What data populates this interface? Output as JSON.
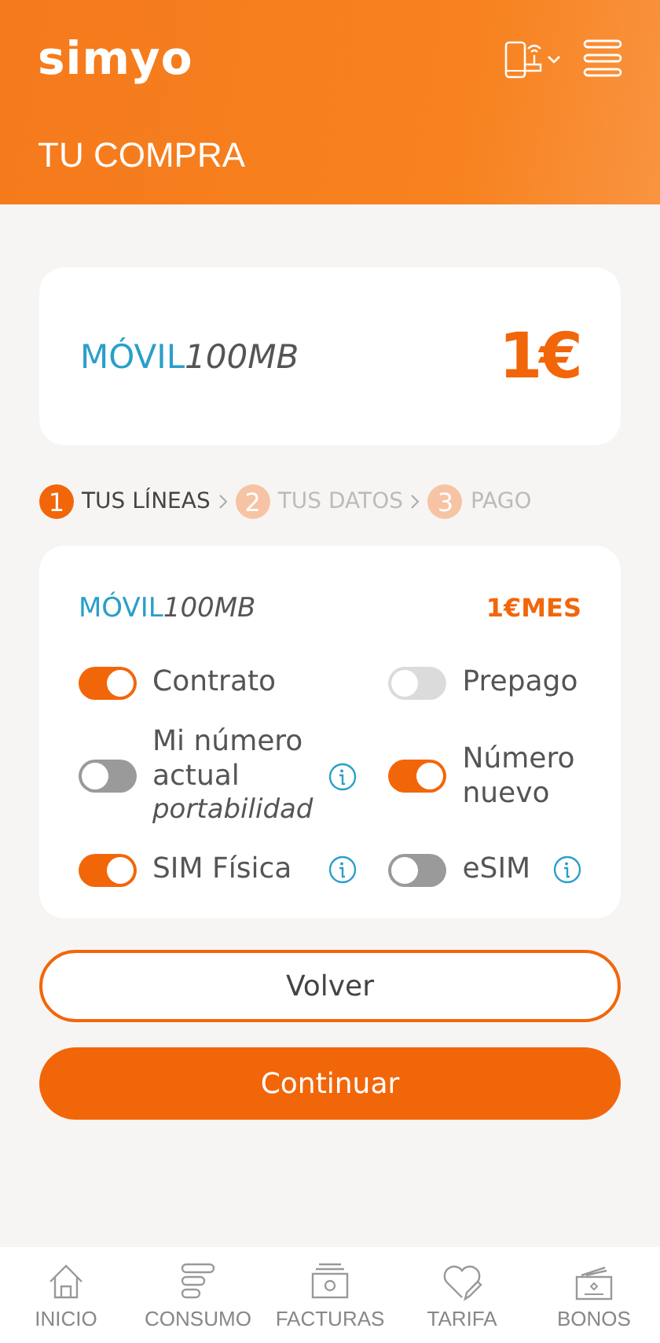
{
  "header": {
    "logo": "simyo",
    "title": "TU COMPRA"
  },
  "product": {
    "name": "MÓVIL",
    "plan": "100MB",
    "price": "1€"
  },
  "steps": [
    {
      "number": "1",
      "label": "TUS LÍNEAS",
      "selected": true
    },
    {
      "number": "2",
      "label": "TUS DATOS",
      "selected": false
    },
    {
      "number": "3",
      "label": "PAGO",
      "selected": false
    }
  ],
  "line": {
    "name": "MÓVIL",
    "plan": "100MB",
    "price": "1€MES",
    "options": [
      {
        "label": "Contrato",
        "checked": true,
        "disabled": false
      },
      {
        "label": "Prepago",
        "checked": false,
        "disabled": true
      },
      {
        "label": "Mi número actual",
        "note": "portabilidad",
        "checked": false,
        "disabled": false,
        "info": true
      },
      {
        "label": "Número nuevo",
        "checked": true,
        "disabled": false,
        "info": false
      },
      {
        "label": "SIM Física",
        "checked": true,
        "disabled": false,
        "info": true
      },
      {
        "label": "eSIM",
        "checked": false,
        "disabled": false,
        "info": true
      }
    ]
  },
  "buttons": [
    {
      "label": "Volver",
      "kind": "outline"
    },
    {
      "label": "Continuar",
      "kind": "primary"
    }
  ],
  "nav": [
    {
      "label": "INICIO",
      "kind": "home"
    },
    {
      "label": "CONSUMO",
      "kind": "usage"
    },
    {
      "label": "FACTURAS",
      "kind": "bills"
    },
    {
      "label": "TARIFA",
      "kind": "tariff"
    },
    {
      "label": "BONOS",
      "kind": "bonus"
    }
  ]
}
